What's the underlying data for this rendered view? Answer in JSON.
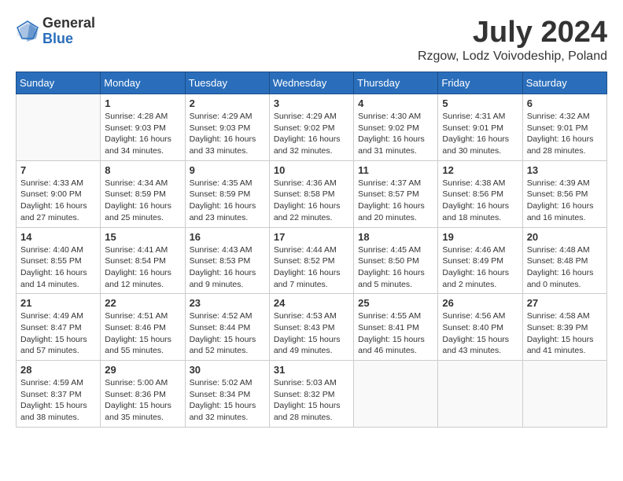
{
  "logo": {
    "general": "General",
    "blue": "Blue"
  },
  "title": "July 2024",
  "location": "Rzgow, Lodz Voivodeship, Poland",
  "days_of_week": [
    "Sunday",
    "Monday",
    "Tuesday",
    "Wednesday",
    "Thursday",
    "Friday",
    "Saturday"
  ],
  "weeks": [
    [
      {
        "day": "",
        "info": ""
      },
      {
        "day": "1",
        "info": "Sunrise: 4:28 AM\nSunset: 9:03 PM\nDaylight: 16 hours\nand 34 minutes."
      },
      {
        "day": "2",
        "info": "Sunrise: 4:29 AM\nSunset: 9:03 PM\nDaylight: 16 hours\nand 33 minutes."
      },
      {
        "day": "3",
        "info": "Sunrise: 4:29 AM\nSunset: 9:02 PM\nDaylight: 16 hours\nand 32 minutes."
      },
      {
        "day": "4",
        "info": "Sunrise: 4:30 AM\nSunset: 9:02 PM\nDaylight: 16 hours\nand 31 minutes."
      },
      {
        "day": "5",
        "info": "Sunrise: 4:31 AM\nSunset: 9:01 PM\nDaylight: 16 hours\nand 30 minutes."
      },
      {
        "day": "6",
        "info": "Sunrise: 4:32 AM\nSunset: 9:01 PM\nDaylight: 16 hours\nand 28 minutes."
      }
    ],
    [
      {
        "day": "7",
        "info": "Sunrise: 4:33 AM\nSunset: 9:00 PM\nDaylight: 16 hours\nand 27 minutes."
      },
      {
        "day": "8",
        "info": "Sunrise: 4:34 AM\nSunset: 8:59 PM\nDaylight: 16 hours\nand 25 minutes."
      },
      {
        "day": "9",
        "info": "Sunrise: 4:35 AM\nSunset: 8:59 PM\nDaylight: 16 hours\nand 23 minutes."
      },
      {
        "day": "10",
        "info": "Sunrise: 4:36 AM\nSunset: 8:58 PM\nDaylight: 16 hours\nand 22 minutes."
      },
      {
        "day": "11",
        "info": "Sunrise: 4:37 AM\nSunset: 8:57 PM\nDaylight: 16 hours\nand 20 minutes."
      },
      {
        "day": "12",
        "info": "Sunrise: 4:38 AM\nSunset: 8:56 PM\nDaylight: 16 hours\nand 18 minutes."
      },
      {
        "day": "13",
        "info": "Sunrise: 4:39 AM\nSunset: 8:56 PM\nDaylight: 16 hours\nand 16 minutes."
      }
    ],
    [
      {
        "day": "14",
        "info": "Sunrise: 4:40 AM\nSunset: 8:55 PM\nDaylight: 16 hours\nand 14 minutes."
      },
      {
        "day": "15",
        "info": "Sunrise: 4:41 AM\nSunset: 8:54 PM\nDaylight: 16 hours\nand 12 minutes."
      },
      {
        "day": "16",
        "info": "Sunrise: 4:43 AM\nSunset: 8:53 PM\nDaylight: 16 hours\nand 9 minutes."
      },
      {
        "day": "17",
        "info": "Sunrise: 4:44 AM\nSunset: 8:52 PM\nDaylight: 16 hours\nand 7 minutes."
      },
      {
        "day": "18",
        "info": "Sunrise: 4:45 AM\nSunset: 8:50 PM\nDaylight: 16 hours\nand 5 minutes."
      },
      {
        "day": "19",
        "info": "Sunrise: 4:46 AM\nSunset: 8:49 PM\nDaylight: 16 hours\nand 2 minutes."
      },
      {
        "day": "20",
        "info": "Sunrise: 4:48 AM\nSunset: 8:48 PM\nDaylight: 16 hours\nand 0 minutes."
      }
    ],
    [
      {
        "day": "21",
        "info": "Sunrise: 4:49 AM\nSunset: 8:47 PM\nDaylight: 15 hours\nand 57 minutes."
      },
      {
        "day": "22",
        "info": "Sunrise: 4:51 AM\nSunset: 8:46 PM\nDaylight: 15 hours\nand 55 minutes."
      },
      {
        "day": "23",
        "info": "Sunrise: 4:52 AM\nSunset: 8:44 PM\nDaylight: 15 hours\nand 52 minutes."
      },
      {
        "day": "24",
        "info": "Sunrise: 4:53 AM\nSunset: 8:43 PM\nDaylight: 15 hours\nand 49 minutes."
      },
      {
        "day": "25",
        "info": "Sunrise: 4:55 AM\nSunset: 8:41 PM\nDaylight: 15 hours\nand 46 minutes."
      },
      {
        "day": "26",
        "info": "Sunrise: 4:56 AM\nSunset: 8:40 PM\nDaylight: 15 hours\nand 43 minutes."
      },
      {
        "day": "27",
        "info": "Sunrise: 4:58 AM\nSunset: 8:39 PM\nDaylight: 15 hours\nand 41 minutes."
      }
    ],
    [
      {
        "day": "28",
        "info": "Sunrise: 4:59 AM\nSunset: 8:37 PM\nDaylight: 15 hours\nand 38 minutes."
      },
      {
        "day": "29",
        "info": "Sunrise: 5:00 AM\nSunset: 8:36 PM\nDaylight: 15 hours\nand 35 minutes."
      },
      {
        "day": "30",
        "info": "Sunrise: 5:02 AM\nSunset: 8:34 PM\nDaylight: 15 hours\nand 32 minutes."
      },
      {
        "day": "31",
        "info": "Sunrise: 5:03 AM\nSunset: 8:32 PM\nDaylight: 15 hours\nand 28 minutes."
      },
      {
        "day": "",
        "info": ""
      },
      {
        "day": "",
        "info": ""
      },
      {
        "day": "",
        "info": ""
      }
    ]
  ]
}
